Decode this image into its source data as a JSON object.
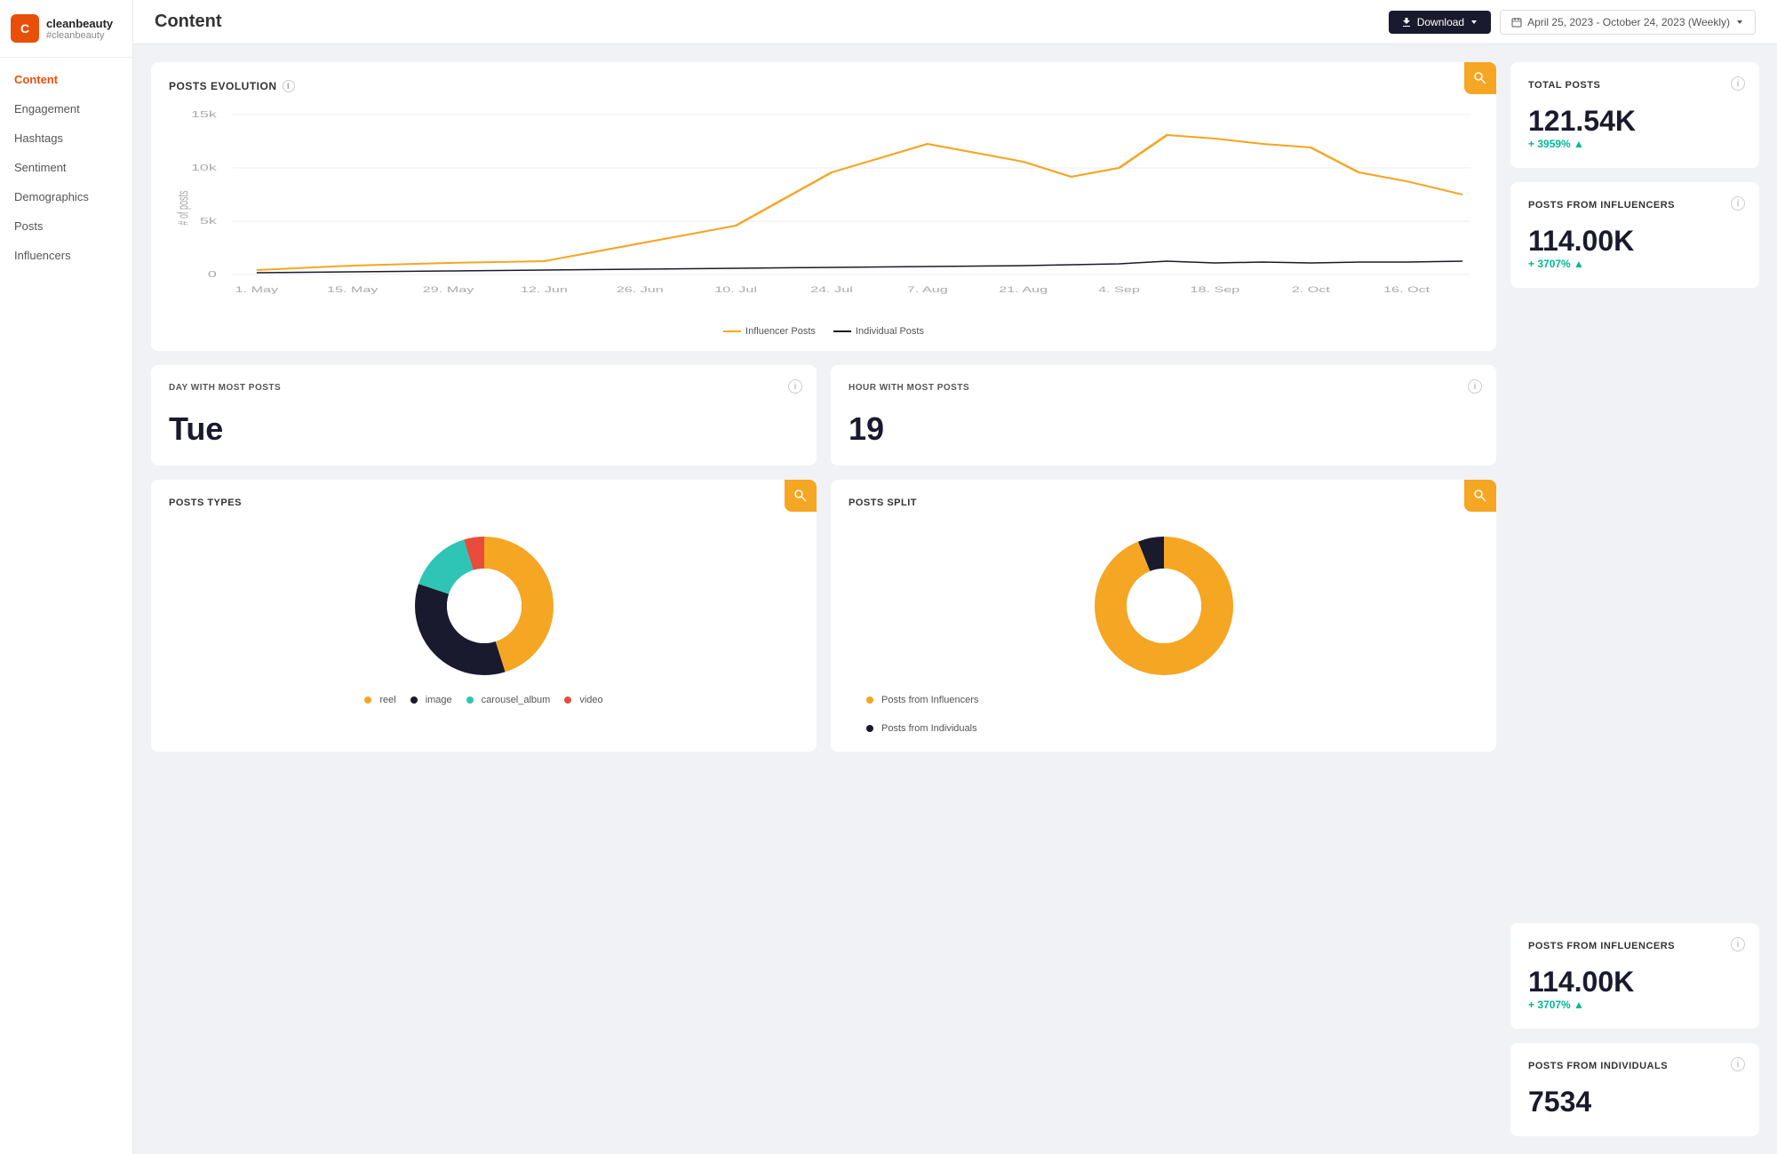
{
  "sidebar": {
    "logo": {
      "initials": "C",
      "name": "cleanbeauty",
      "tag": "#cleanbeauty"
    },
    "nav_items": [
      {
        "label": "Content",
        "active": true
      },
      {
        "label": "Engagement",
        "active": false
      },
      {
        "label": "Hashtags",
        "active": false
      },
      {
        "label": "Sentiment",
        "active": false
      },
      {
        "label": "Demographics",
        "active": false
      },
      {
        "label": "Posts",
        "active": false
      },
      {
        "label": "Influencers",
        "active": false
      }
    ]
  },
  "header": {
    "title": "Content",
    "download_label": "Download",
    "date_range": "April 25, 2023 - October 24, 2023 (Weekly)"
  },
  "total_posts": {
    "label": "TOTAL POSTS",
    "value": "121.54K",
    "change": "+ 3959% ▲"
  },
  "posts_from_influencers_top": {
    "label": "POSTS FROM INFLUENCERS",
    "value": "114.00K",
    "change": "+ 3707% ▲"
  },
  "day_most_posts": {
    "label": "DAY WITH MOST POSTS",
    "value": "Tue"
  },
  "hour_most_posts": {
    "label": "HOUR WITH MOST POSTS",
    "value": "19"
  },
  "posts_evolution": {
    "title": "POSTS EVOLUTION",
    "legend": {
      "influencer": "Influencer Posts",
      "individual": "Individual Posts"
    },
    "y_axis_labels": [
      "15k",
      "10k",
      "5k",
      "0"
    ],
    "x_axis_labels": [
      "1. May",
      "15. May",
      "29. May",
      "12. Jun",
      "26. Jun",
      "10. Jul",
      "24. Jul",
      "7. Aug",
      "21. Aug",
      "4. Sep",
      "18. Sep",
      "2. Oct",
      "16. Oct"
    ]
  },
  "posts_types": {
    "title": "POSTS TYPES",
    "legend": [
      {
        "label": "reel",
        "color": "#f5a623"
      },
      {
        "label": "image",
        "color": "#1a1a2e"
      },
      {
        "label": "carousel_album",
        "color": "#2ec4b6"
      },
      {
        "label": "video",
        "color": "#e74c3c"
      }
    ]
  },
  "posts_split": {
    "title": "POSTS SPLIT",
    "legend": [
      {
        "label": "Posts from Influencers",
        "color": "#f5a623"
      },
      {
        "label": "Posts from Individuals",
        "color": "#1a1a2e"
      }
    ]
  },
  "posts_from_influencers_bottom": {
    "label": "POSTS FROM INFLUENCERS",
    "value": "114.00K",
    "change": "+ 3707% ▲"
  },
  "posts_from_individuals": {
    "label": "POSTS FROM INDIVIDUALS",
    "value": "7534"
  },
  "colors": {
    "accent": "#e8500a",
    "dark": "#1a1a2e",
    "orange": "#f5a623",
    "teal": "#2ec4b6",
    "green": "#00b894",
    "red": "#e74c3c"
  }
}
